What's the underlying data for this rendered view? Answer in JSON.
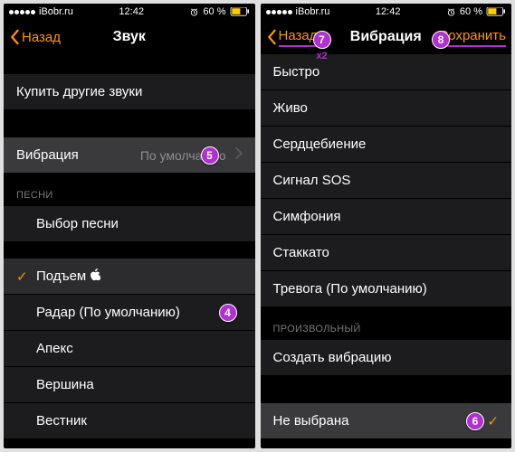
{
  "status": {
    "carrier": "iBobr.ru",
    "time": "12:42",
    "battery_pct": "60 %"
  },
  "left": {
    "nav": {
      "back": "Назад",
      "title": "Звук"
    },
    "buy": "Купить другие звуки",
    "vibration_label": "Вибрация",
    "vibration_value": "По умолчанию",
    "section_songs": "Песни",
    "choose_song": "Выбор песни",
    "items": [
      {
        "label": "Подъем",
        "checked": true,
        "apple": true
      },
      {
        "label": "Радар (По умолчанию)"
      },
      {
        "label": "Апекс"
      },
      {
        "label": "Вершина"
      },
      {
        "label": "Вестник"
      }
    ]
  },
  "right": {
    "nav": {
      "back": "Назад",
      "title": "Вибрация",
      "save": "Сохранить"
    },
    "items": [
      {
        "label": "Быстро"
      },
      {
        "label": "Живо"
      },
      {
        "label": "Сердцебиение"
      },
      {
        "label": "Сигнал SOS"
      },
      {
        "label": "Симфония"
      },
      {
        "label": "Стаккато"
      },
      {
        "label": "Тревога (По умолчанию)"
      }
    ],
    "section_custom": "Произвольный",
    "create": "Создать вибрацию",
    "none": "Не выбрана"
  },
  "annotations": {
    "n4": "4",
    "n5": "5",
    "n6": "6",
    "n7": "7",
    "n8": "8",
    "x2": "x2"
  }
}
